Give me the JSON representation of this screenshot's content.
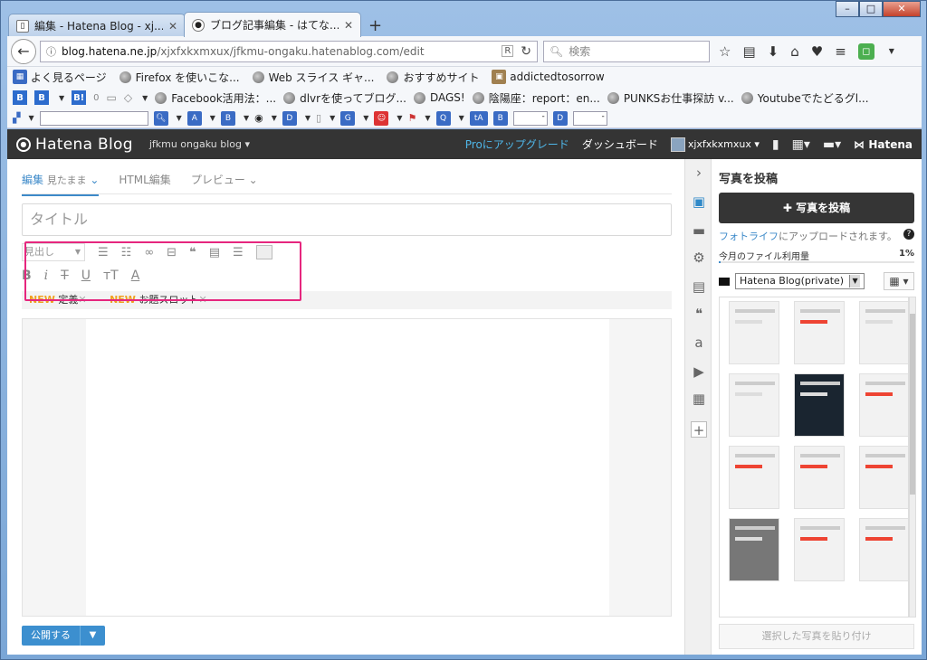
{
  "browser": {
    "tabs": [
      {
        "title": "編集 - Hatena Blog - xj...",
        "favicon": "page-icon"
      },
      {
        "title": "ブログ記事編集 - はてな...",
        "favicon": "hatena-icon"
      }
    ],
    "url_host": "blog.hatena.ne.jp",
    "url_path": "/xjxfxkxmxux/jfkmu-ongaku.hatenablog.com/edit",
    "search_placeholder": "検索",
    "bookmarks_row1": [
      "よく見るページ",
      "Firefox を使いこな...",
      "Web スライス ギャ...",
      "おすすめサイト",
      "addictedtosorrow"
    ],
    "bookmarks_row2_count": "0",
    "bookmarks_row2": [
      "Facebook活用法：...",
      "dlvrを使ってブログ...",
      "DAGS!",
      "陰陽座：report：en...",
      "PUNKSお仕事探訪 v...",
      "Youtubeでたどるグl..."
    ],
    "tb3_labels": [
      "A",
      "B",
      "D",
      "G",
      "Q",
      "tA",
      "B",
      "D"
    ]
  },
  "hatena": {
    "logo": "Hatena Blog",
    "blog_name": "jfkmu ongaku blog",
    "pro_link": "Proにアップグレード",
    "dashboard": "ダッシュボード",
    "user": "xjxfxkxmxux",
    "brand": "Hatena"
  },
  "editor": {
    "mode_tabs": {
      "edit": "編集",
      "edit_sub": "見たまま",
      "html": "HTML編集",
      "preview": "プレビュー"
    },
    "title_placeholder": "タイトル",
    "heading_select": "見出し",
    "new_label": "NEW",
    "new_item1": "定義",
    "new_item2": "お題スロット",
    "publish": "公開する"
  },
  "panel": {
    "title": "写真を投稿",
    "upload_button": "写真を投稿",
    "fotolife_link": "フォトライフ",
    "fotolife_text": "にアップロードされます。",
    "usage_label": "今月のファイル利用量",
    "usage_pct": "1%",
    "usage_value": 0.01,
    "album": "Hatena Blog(private)",
    "paste_button": "選択した写真を貼り付け"
  }
}
